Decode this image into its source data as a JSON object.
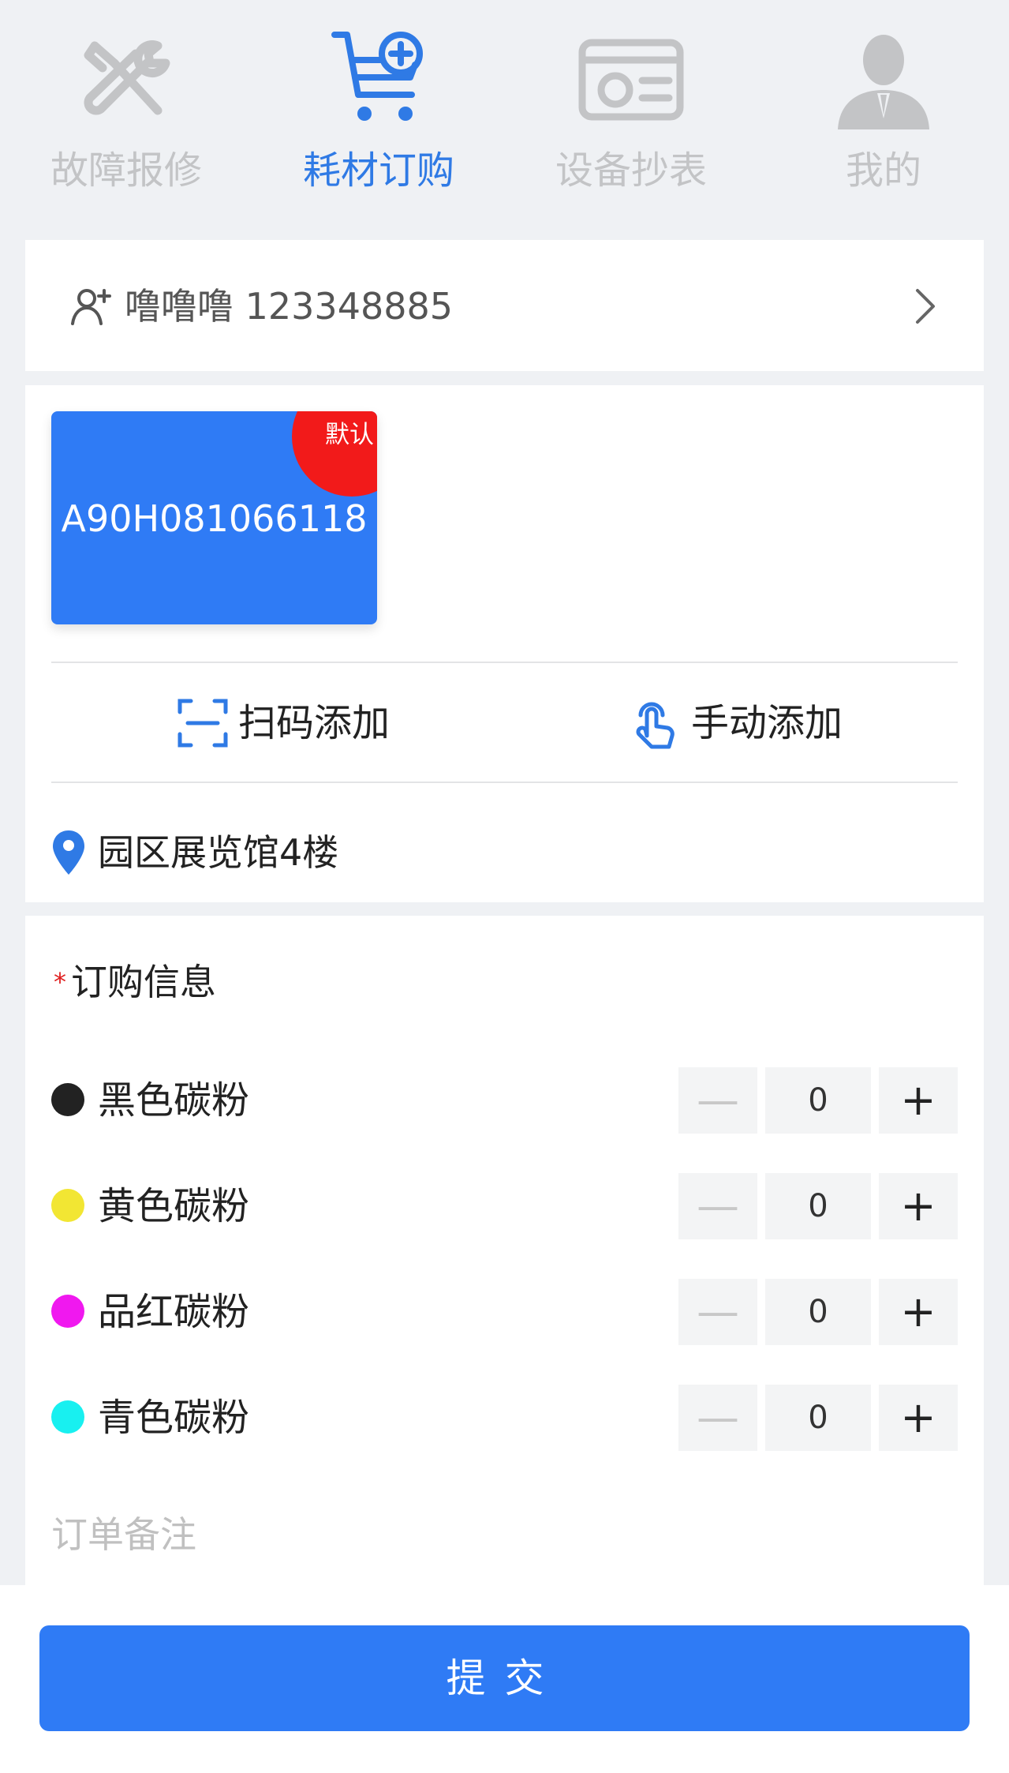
{
  "nav": {
    "tabs": [
      {
        "label": "故障报修",
        "icon": "wrench-screwdriver-icon",
        "active": false
      },
      {
        "label": "耗材订购",
        "icon": "cart-plus-icon",
        "active": true
      },
      {
        "label": "设备抄表",
        "icon": "meter-card-icon",
        "active": false
      },
      {
        "label": "我的",
        "icon": "person-icon",
        "active": false
      }
    ]
  },
  "user": {
    "text": "噜噜噜 123348885",
    "icon": "add-user-icon"
  },
  "device": {
    "code": "A90H081066118",
    "badge": "默认",
    "scan_label": "扫码添加",
    "manual_label": "手动添加",
    "location": "园区展览馆4楼"
  },
  "order": {
    "required_mark": "*",
    "title": "订购信息",
    "items": [
      {
        "name": "黑色碳粉",
        "qty": "0",
        "color": "#222222"
      },
      {
        "name": "黄色碳粉",
        "qty": "0",
        "color": "#f2e633"
      },
      {
        "name": "品红碳粉",
        "qty": "0",
        "color": "#f018ef"
      },
      {
        "name": "青色碳粉",
        "qty": "0",
        "color": "#18f0f0"
      }
    ],
    "minus_label": "—",
    "plus_label": "+",
    "remark_placeholder": "订单备注"
  },
  "submit_label": "提交",
  "colors": {
    "accent": "#2f7bf5",
    "badge": "#f21a1a",
    "inactive": "#c3c4c6"
  }
}
